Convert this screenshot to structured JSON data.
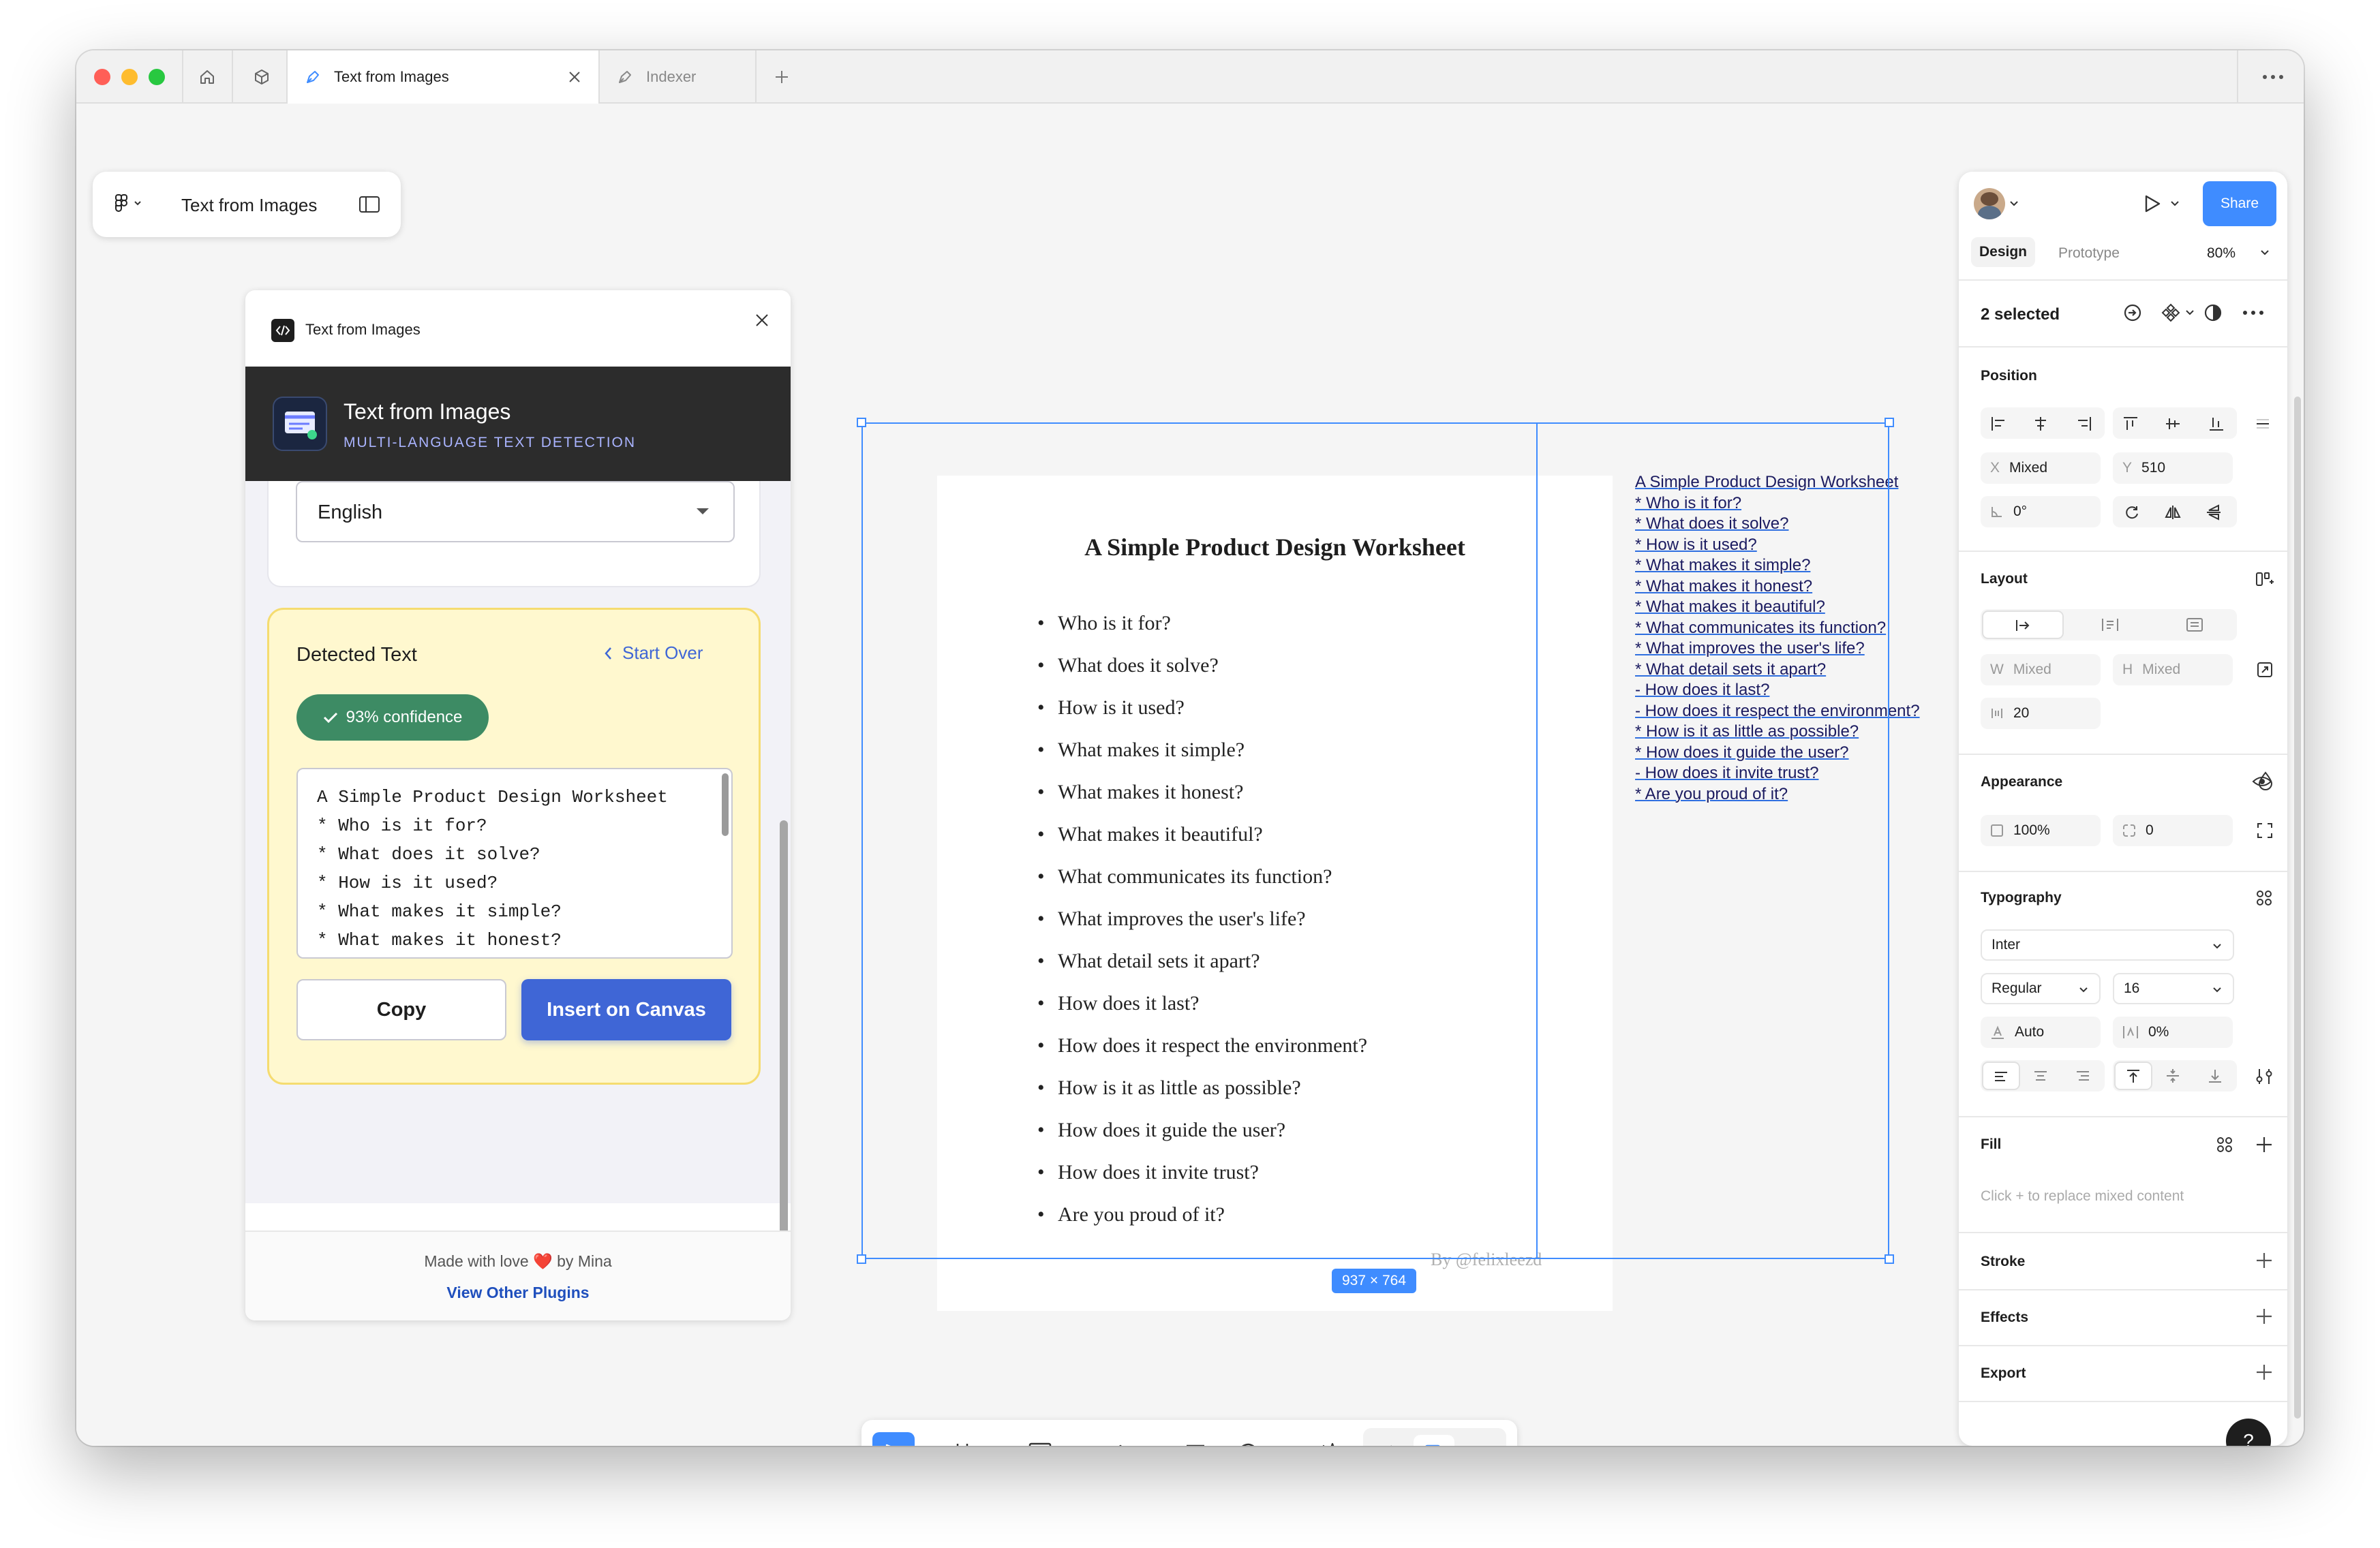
{
  "tabs": {
    "active": "Text from Images",
    "other": "Indexer"
  },
  "file": {
    "name": "Text from Images"
  },
  "plugin": {
    "window_title": "Text from Images",
    "header_title": "Text from Images",
    "header_subtitle": "MULTI-LANGUAGE TEXT DETECTION",
    "language": "English",
    "detected_label": "Detected Text",
    "start_over": "Start Over",
    "confidence": "93% confidence",
    "text_lines": [
      "A Simple Product Design Worksheet",
      "* Who is it for?",
      "* What does it solve?",
      "* How is it used?",
      "* What makes it simple?",
      "* What makes it honest?"
    ],
    "copy_label": "Copy",
    "insert_label": "Insert on Canvas",
    "footer_made": "Made with love ❤️ by Mina",
    "footer_link": "View Other Plugins"
  },
  "worksheet": {
    "title": "A Simple Product Design Worksheet",
    "questions": [
      "Who is it for?",
      "What does it solve?",
      "How is it used?",
      "What makes it simple?",
      "What makes it honest?",
      "What makes it beautiful?",
      "What communicates its function?",
      "What improves the user's life?",
      "What detail sets it apart?",
      "How does it last?",
      "How does it respect the environment?",
      "How is it as little as possible?",
      "How does it guide the user?",
      "How does it invite trust?",
      "Are you proud of it?"
    ],
    "signature": "By @felixleezd"
  },
  "ocr_output": [
    "A Simple Product Design Worksheet",
    "* Who is it for?",
    "* What does it solve?",
    "* How is it used?",
    "* What makes it simple?",
    "* What makes it honest?",
    "* What makes it beautiful?",
    "* What communicates its function?",
    "* What improves the user's life?",
    "* What detail sets it apart?",
    "- How does it last?",
    "- How does it respect the environment?",
    "* How is it as little as possible?",
    "* How does it guide the user?",
    "- How does it invite trust?",
    "* Are you proud of it?"
  ],
  "selection_size": "937 × 764",
  "panel": {
    "share": "Share",
    "tabs": [
      "Design",
      "Prototype"
    ],
    "zoom": "80%",
    "selected": "2 selected",
    "position_title": "Position",
    "x_label": "X",
    "x_value": "Mixed",
    "y_label": "Y",
    "y_value": "510",
    "rotation": "0°",
    "layout_title": "Layout",
    "w_label": "W",
    "w_value": "Mixed",
    "h_label": "H",
    "h_value": "Mixed",
    "gap": "20",
    "appearance_title": "Appearance",
    "opacity": "100%",
    "radius": "0",
    "typography_title": "Typography",
    "font_family": "Inter",
    "font_weight": "Regular",
    "font_size": "16",
    "line_height": "Auto",
    "letter_spacing": "0%",
    "fill_title": "Fill",
    "fill_hint": "Click + to replace mixed content",
    "stroke_title": "Stroke",
    "effects_title": "Effects",
    "export_title": "Export",
    "help": "?"
  },
  "colors": {
    "accent": "#3f8cff",
    "plugin_header": "#2c2c2c",
    "confidence": "#3d8b64",
    "insert": "#3f66d6",
    "detected_bg": "#fff8cf"
  }
}
